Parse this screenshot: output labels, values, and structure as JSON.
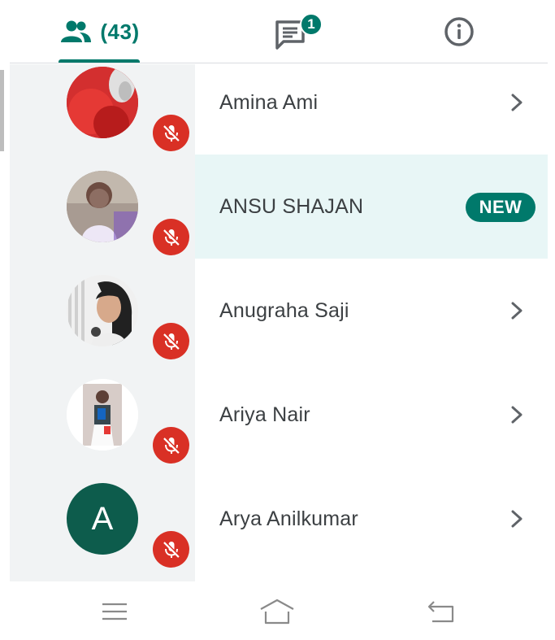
{
  "tabs": {
    "people": {
      "icon": "people-icon",
      "count": "(43)",
      "selected": true
    },
    "chat": {
      "icon": "chat-icon",
      "badge": "1"
    },
    "info": {
      "icon": "info-icon"
    }
  },
  "participants": [
    {
      "name": "Amina Ami",
      "avatar": "photo",
      "muted": true,
      "trailing": "chevron"
    },
    {
      "name": "ANSU SHAJAN",
      "avatar": "photo",
      "muted": true,
      "trailing": "new-badge",
      "badge": "NEW",
      "highlighted": true
    },
    {
      "name": "Anugraha Saji",
      "avatar": "photo",
      "muted": true,
      "trailing": "chevron"
    },
    {
      "name": "Ariya Nair",
      "avatar": "photo",
      "muted": true,
      "trailing": "chevron"
    },
    {
      "name": "Arya Anilkumar",
      "avatar": "letter",
      "letter": "A",
      "muted": true,
      "trailing": "chevron"
    }
  ],
  "navbar": {
    "items": [
      "menu-icon",
      "home-icon",
      "back-icon"
    ]
  },
  "colors": {
    "accent": "#00796b",
    "muted_red": "#d93025",
    "highlight_row": "#e8f6f6",
    "list_left_bg": "#f1f3f4",
    "letter_avatar": "#0d5c4c"
  }
}
